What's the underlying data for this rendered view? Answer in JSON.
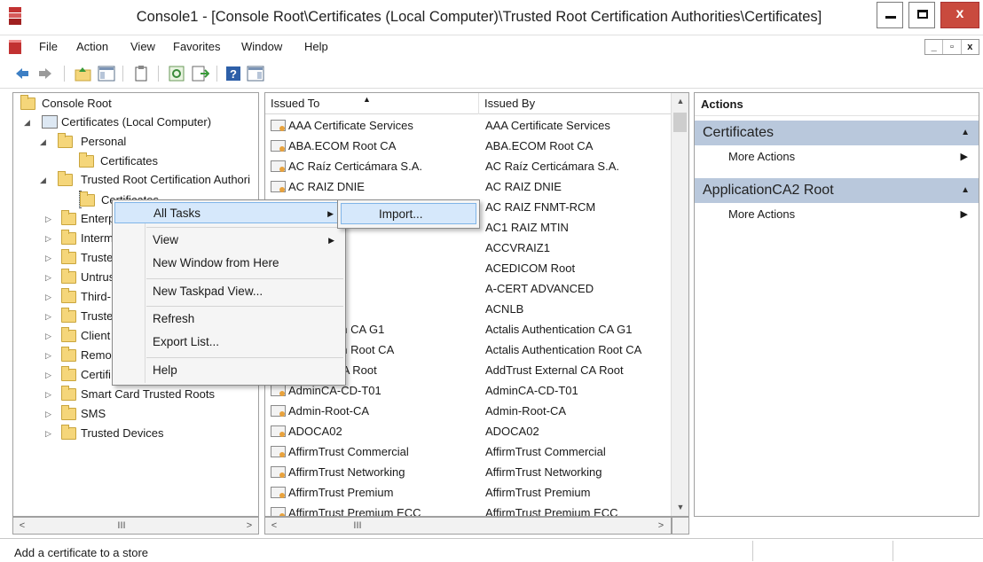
{
  "window": {
    "title": "Console1 - [Console Root\\Certificates (Local Computer)\\Trusted Root Certification Authorities\\Certificates]",
    "minimize": "",
    "maximize": "",
    "close": "x"
  },
  "menubar": {
    "items": [
      "File",
      "Action",
      "View",
      "Favorites",
      "Window",
      "Help"
    ],
    "mdi_minimize": "_",
    "mdi_restore": "▫",
    "mdi_close": "x"
  },
  "toolbar": {
    "icons": [
      "back-icon",
      "forward-icon",
      "up-folder-icon",
      "show-hide-tree-icon",
      "properties-icon",
      "refresh-icon",
      "export-list-icon",
      "help-icon",
      "show-hide-action-pane-icon"
    ]
  },
  "tree": {
    "root": "Console Root",
    "computer": "Certificates (Local Computer)",
    "personal": "Personal",
    "personal_certs": "Certificates",
    "trusted_root": "Trusted Root Certification Authori",
    "trusted_root_certs": "Certificates",
    "partial_items": [
      "Enterp",
      "Interm",
      "Truste",
      "Untrus",
      "Third-",
      "Truste",
      "Client",
      "Remo",
      "Certifi"
    ],
    "smart_card": "Smart Card Trusted Roots",
    "sms": "SMS",
    "trusted_devices": "Trusted Devices",
    "scroll_thumb": "III"
  },
  "table": {
    "headers": [
      "Issued To",
      "Issued By"
    ],
    "rows": [
      [
        "AAA Certificate Services",
        "AAA Certificate Services"
      ],
      [
        "ABA.ECOM Root CA",
        "ABA.ECOM Root CA"
      ],
      [
        "AC Raíz Certicámara S.A.",
        "AC Raíz Certicámara S.A."
      ],
      [
        "AC RAIZ DNIE",
        "AC RAIZ DNIE"
      ],
      [
        "",
        "AC RAIZ FNMT-RCM"
      ],
      [
        "",
        "AC1 RAIZ MTIN"
      ],
      [
        "Z1",
        "ACCVRAIZ1"
      ],
      [
        "M Root",
        "ACEDICOM Root"
      ],
      [
        "DVANCED",
        "A-CERT ADVANCED"
      ],
      [
        "",
        "ACNLB"
      ],
      [
        "thentication CA G1",
        "Actalis Authentication CA G1"
      ],
      [
        "thentication Root CA",
        "Actalis Authentication Root CA"
      ],
      [
        "External CA Root",
        "AddTrust External CA Root"
      ],
      [
        "AdminCA-CD-T01",
        "AdminCA-CD-T01"
      ],
      [
        "Admin-Root-CA",
        "Admin-Root-CA"
      ],
      [
        "ADOCA02",
        "ADOCA02"
      ],
      [
        "AffirmTrust Commercial",
        "AffirmTrust Commercial"
      ],
      [
        "AffirmTrust Networking",
        "AffirmTrust Networking"
      ],
      [
        "AffirmTrust Premium",
        "AffirmTrust Premium"
      ],
      [
        "AffirmTrust Premium ECC",
        "AffirmTrust Premium ECC"
      ]
    ],
    "scroll_thumb": "III"
  },
  "actions": {
    "header": "Actions",
    "sections": [
      {
        "title": "Certificates",
        "item": "More Actions"
      },
      {
        "title": "ApplicationCA2 Root",
        "item": "More Actions"
      }
    ]
  },
  "context_menu": {
    "items": [
      "All Tasks",
      "View",
      "New Window from Here",
      "New Taskpad View...",
      "Refresh",
      "Export List...",
      "Help"
    ],
    "submenu_item": "Import..."
  },
  "status": {
    "text": "Add a certificate to a store"
  },
  "colors": {
    "action_section": "#b9c8dc",
    "menu_highlight": "#d6e8fb",
    "close_button": "#c94a3e"
  }
}
